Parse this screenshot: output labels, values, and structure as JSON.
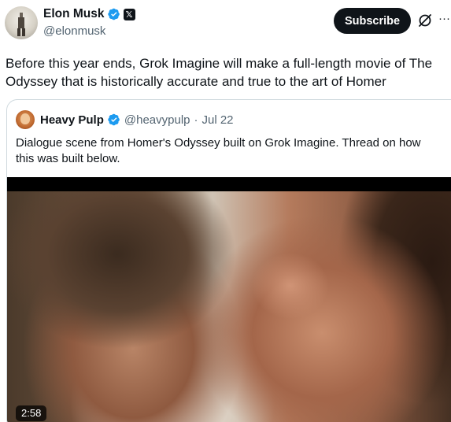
{
  "author": {
    "display_name": "Elon Musk",
    "handle": "@elonmusk",
    "badge_icon": "x-logo-icon"
  },
  "actions": {
    "subscribe_label": "Subscribe",
    "grok_icon": "grok-icon",
    "more_label": "···"
  },
  "tweet": {
    "text": "Before this year ends, Grok Imagine will make a full-length movie of The Odyssey that is historically accurate and true to the art of Homer"
  },
  "quoted": {
    "display_name": "Heavy Pulp",
    "handle": "@heavypulp",
    "separator": "·",
    "date": "Jul 22",
    "text": "Dialogue scene from Homer's Odyssey built on Grok Imagine. Thread on how this was built below.",
    "video": {
      "duration": "2:58"
    }
  },
  "colors": {
    "verified_blue": "#1d9bf0",
    "text_primary": "#0f1419",
    "text_secondary": "#536471",
    "border": "#cfd9de"
  }
}
